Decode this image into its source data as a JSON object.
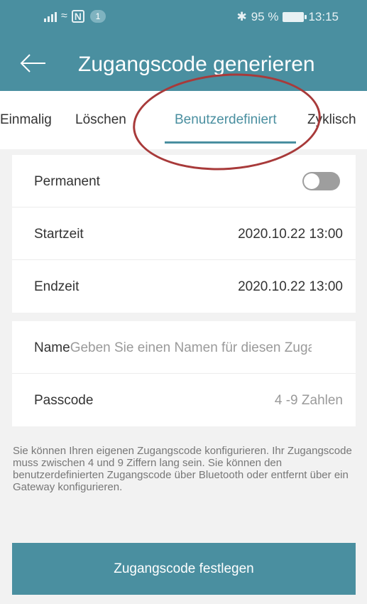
{
  "status_bar": {
    "notification_count": "1",
    "battery": "95 %",
    "time": "13:15",
    "icons": [
      "signal-icon",
      "wifi-icon",
      "nfc-icon",
      "bluetooth-icon",
      "battery-icon"
    ]
  },
  "header": {
    "title": "Zugangscode generieren",
    "back_icon": "arrow-left-icon",
    "background_color": "#4a8fa0"
  },
  "tabs": [
    {
      "label": "Einmalig"
    },
    {
      "label": "Löschen"
    },
    {
      "label": "Benutzerdefiniert",
      "active": true
    },
    {
      "label": "Zyklisch"
    }
  ],
  "annotation": {
    "color": "#a83a3a",
    "shape": "ellipse around active tab"
  },
  "time_card": {
    "permanent_label": "Permanent",
    "permanent_enabled": false,
    "start_label": "Startzeit",
    "start_value": "2020.10.22 13:00",
    "end_label": "Endzeit",
    "end_value": "2020.10.22 13:00"
  },
  "code_card": {
    "name_label": "Name",
    "name_placeholder": "Geben Sie einen Namen für diesen Zugan...",
    "passcode_label": "Passcode",
    "passcode_placeholder": "4 -9 Zahlen"
  },
  "info_text": "Sie können Ihren eigenen Zugangscode konfigurieren. Ihr Zugangscode muss zwischen 4 und 9 Ziffern lang sein. Sie können den benutzerdefinierten Zugangscode über Bluetooth oder entfernt über ein Gateway konfigurieren.",
  "primary_button": "Zugangscode festlegen"
}
